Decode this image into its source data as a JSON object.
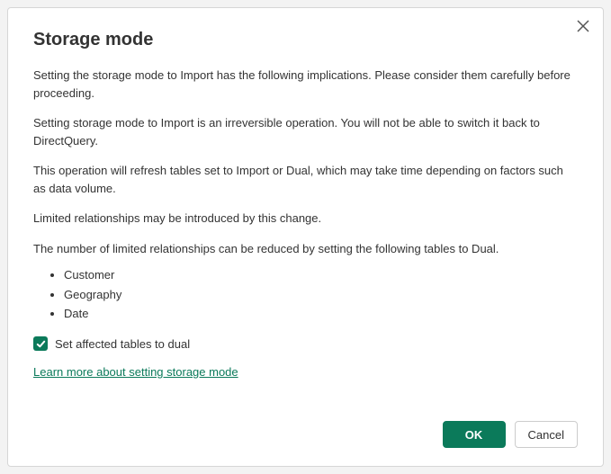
{
  "dialog": {
    "title": "Storage mode",
    "paragraphs": {
      "p1": "Setting the storage mode to Import has the following implications. Please consider them carefully before proceeding.",
      "p2": "Setting storage mode to Import is an irreversible operation.  You will not be able to switch it back to DirectQuery.",
      "p3": "This operation will refresh tables set to Import or Dual, which may take time depending on factors such as data volume.",
      "p4": "Limited relationships may be introduced by this change.",
      "p5": "The number of limited relationships can be reduced by setting the following tables to Dual."
    },
    "tables": [
      "Customer",
      "Geography",
      "Date"
    ],
    "checkbox": {
      "label": "Set affected tables to dual",
      "checked": true
    },
    "learn_more": "Learn more about setting storage mode",
    "buttons": {
      "ok": "OK",
      "cancel": "Cancel"
    }
  }
}
